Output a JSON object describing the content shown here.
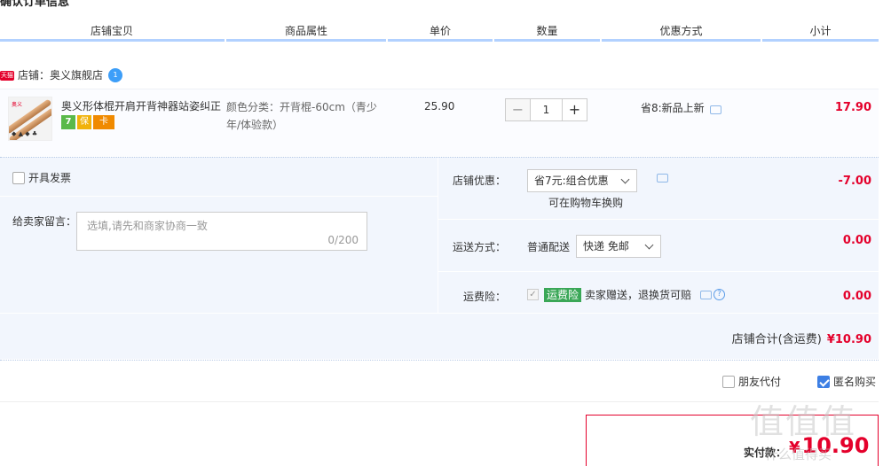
{
  "page": {
    "heading": "确认订单信息"
  },
  "columns": [
    "店铺宝贝",
    "商品属性",
    "单价",
    "数量",
    "优惠方式",
    "小计"
  ],
  "shop": {
    "badge": "天猫",
    "label": "店铺：奥义旗舰店",
    "ww_icon_text": "1"
  },
  "item": {
    "thumb_tag": "奥义",
    "thumb_marks": "◆ ▲ ◆ ♣",
    "title": "奥义形体棍开肩开背神器站姿纠正器...",
    "service_badges": [
      "7",
      "保",
      "卡"
    ],
    "attribute": "颜色分类：开背棍-60cm（青少年/体验款）",
    "unit_price": "25.90",
    "quantity": "1",
    "qty_minus": "−",
    "qty_plus": "+",
    "promo": "省8:新品上新",
    "subtotal": "17.90"
  },
  "order": {
    "invoice_label": "开具发票",
    "message_label": "给卖家留言：",
    "message_placeholder": "选填,请先和商家协商一致",
    "message_count": "0/200",
    "shop_discount_label": "店铺优惠：",
    "shop_discount_value": "省7元:组合优惠",
    "shop_discount_note": "可在购物车换购",
    "shop_discount_amount": "-7.00",
    "shipping_label": "运送方式：",
    "shipping_method": "普通配送",
    "shipping_option": "快递 免邮",
    "shipping_amount": "0.00",
    "insurance_label": "运费险：",
    "insurance_check": "✓",
    "insurance_tag": "运费险",
    "insurance_note": "卖家赠送，退换货可赔",
    "insurance_help": "?",
    "insurance_amount": "0.00",
    "shop_total_label": "店铺合计(含运费)",
    "shop_total_value": "¥10.90"
  },
  "options": {
    "friend_pay_label": "朋友代付",
    "anonymous_label": "匿名购买",
    "anonymous_checked": true
  },
  "payment": {
    "label": "实付款：",
    "currency": "¥",
    "amount": "10.90"
  },
  "watermark": {
    "main": "值值值",
    "sub": "什么值得买"
  },
  "colors": {
    "price_red": "#e4002b",
    "header_line": "#b2d1ff",
    "panel_bg": "#f2f6fd",
    "checkbox_blue": "#3d7fe4"
  }
}
